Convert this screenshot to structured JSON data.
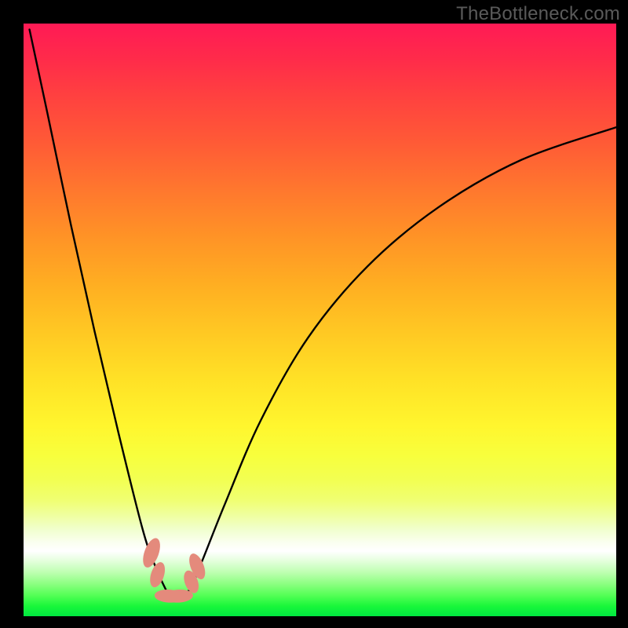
{
  "watermark": "TheBottleneck.com",
  "chart_data": {
    "type": "line",
    "title": "",
    "xlabel": "",
    "ylabel": "",
    "xlim": [
      0,
      100
    ],
    "ylim": [
      0,
      100
    ],
    "series": [
      {
        "name": "curve",
        "x": [
          1,
          4,
          8,
          12,
          16,
          20,
          22,
          24,
          25,
          26,
          28,
          30,
          34,
          40,
          48,
          58,
          70,
          84,
          100
        ],
        "y": [
          99,
          85,
          66,
          48,
          31,
          15,
          9,
          4.5,
          3,
          3,
          4.5,
          9,
          19,
          33,
          47,
          59,
          69,
          77,
          82.5
        ]
      }
    ],
    "markers": [
      {
        "cx": 21.6,
        "cy": 10.7,
        "rx": 1.2,
        "ry": 2.6,
        "rot": 20
      },
      {
        "cx": 22.6,
        "cy": 7.0,
        "rx": 1.1,
        "ry": 2.2,
        "rot": 18
      },
      {
        "cx": 24.5,
        "cy": 3.4,
        "rx": 2.4,
        "ry": 1.1,
        "rot": 3
      },
      {
        "cx": 26.2,
        "cy": 3.4,
        "rx": 2.4,
        "ry": 1.1,
        "rot": -3
      },
      {
        "cx": 28.3,
        "cy": 5.8,
        "rx": 1.1,
        "ry": 2.0,
        "rot": -20
      },
      {
        "cx": 29.3,
        "cy": 8.4,
        "rx": 1.1,
        "ry": 2.3,
        "rot": -22
      }
    ],
    "background_gradient": {
      "top": "#ff1a55",
      "mid": "#ffe126",
      "white_band_at": 89,
      "bottom": "#00e840"
    }
  }
}
